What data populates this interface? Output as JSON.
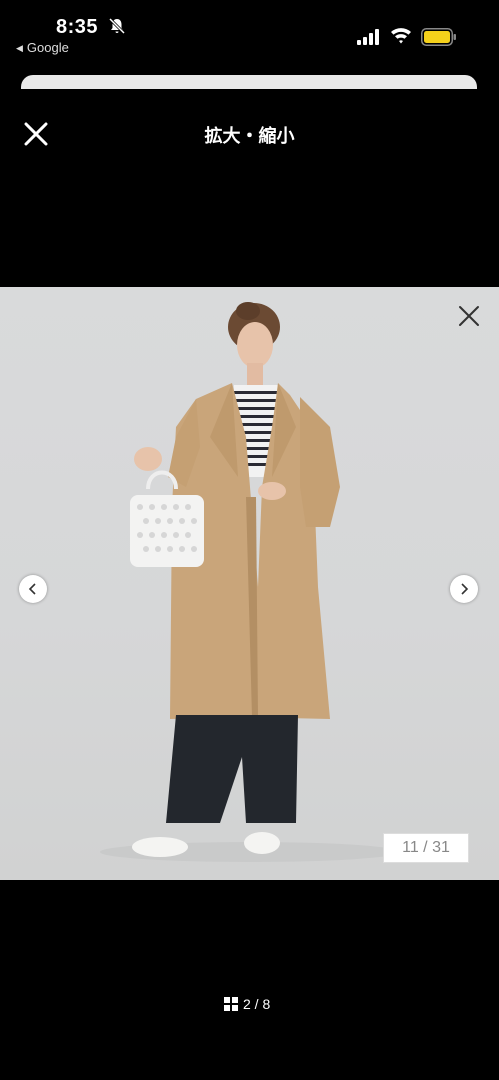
{
  "status_bar": {
    "time": "8:35",
    "back_app_label": "Google",
    "battery_color": "#f5d11b"
  },
  "header": {
    "title": "拡大・縮小"
  },
  "image_viewer": {
    "image_counter": "11 / 31",
    "photo_description_icons": [
      "close-icon",
      "chevron-left-icon",
      "chevron-right-icon"
    ]
  },
  "pager": {
    "label": "2 / 8"
  }
}
